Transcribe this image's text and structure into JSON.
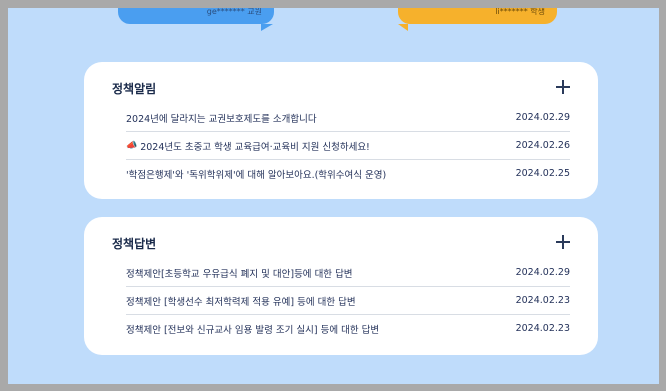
{
  "bubbles": {
    "left_text": "ge******* 교원",
    "right_text": "li******* 학생"
  },
  "notice": {
    "title": "정책알림",
    "items": [
      {
        "title": "2024년에 달라지는 교권보호제도를 소개합니다",
        "date": "2024.02.29",
        "icon": ""
      },
      {
        "title": "2024년도 초중고 학생 교육급여·교육비 지원 신청하세요!",
        "date": "2024.02.26",
        "icon": "📣"
      },
      {
        "title": "'학점은행제'와 '독위학위제'에 대해 알아보아요.(학위수여식 운영)",
        "date": "2024.02.25",
        "icon": ""
      }
    ]
  },
  "answer": {
    "title": "정책답변",
    "items": [
      {
        "title": "정책제안[초등학교 우유급식 폐지 및 대안]등에 대한 답변",
        "date": "2024.02.29"
      },
      {
        "title": "정책제안 [학생선수 최저학력제 적용 유예] 등에 대한 답변",
        "date": "2024.02.23"
      },
      {
        "title": "정책제안 [전보와 신규교사 임용 발령 조기 실시] 등에 대한 답변",
        "date": "2024.02.23"
      }
    ]
  },
  "colors": {
    "background": "#bfdcfb",
    "blue_bubble": "#4a9ef0",
    "yellow_bubble": "#f6b12c"
  }
}
